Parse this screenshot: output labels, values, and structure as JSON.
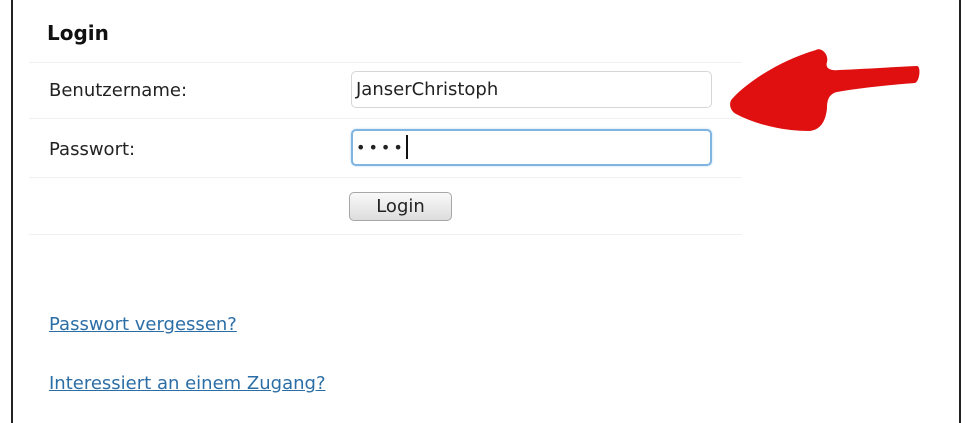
{
  "login_form": {
    "title": "Login",
    "username": {
      "label": "Benutzername:",
      "value": "JanserChristoph"
    },
    "password": {
      "label": "Passwort:",
      "masked_value": "••••"
    },
    "submit_label": "Login"
  },
  "links": {
    "forgot_password": "Passwort vergessen?",
    "request_access": "Interessiert an einem Zugang?"
  },
  "annotation": {
    "icon": "arrow-icon",
    "color": "#e01010"
  },
  "colors": {
    "link": "#2b6ea6",
    "focus_border": "#7fb5e0"
  }
}
